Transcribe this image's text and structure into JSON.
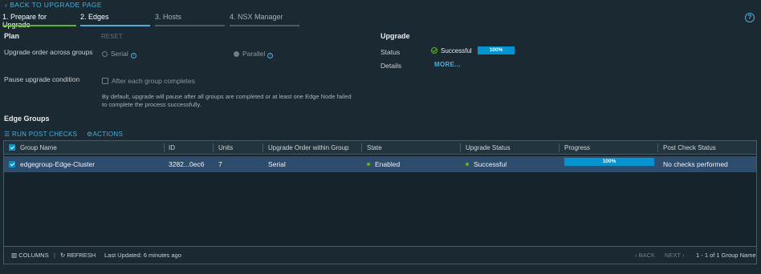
{
  "header": {
    "back_link": "BACK TO UPGRADE PAGE",
    "steps": [
      {
        "label": "1. Prepare for Upgrade",
        "state": "done"
      },
      {
        "label": "2. Edges",
        "state": "active"
      },
      {
        "label": "3. Hosts",
        "state": "future"
      },
      {
        "label": "4. NSX Manager",
        "state": "future"
      }
    ]
  },
  "plan": {
    "title": "Plan",
    "reset_label": "RESET",
    "upgrade_order_label": "Upgrade order across groups",
    "serial_label": "Serial",
    "parallel_label": "Parallel",
    "pause_label": "Pause upgrade condition",
    "pause_checkbox_label": "After each group completes",
    "pause_note_line1": "By default, upgrade will pause after all groups are completed or at least one Edge Node failed",
    "pause_note_line2": "to complete the process successfully."
  },
  "upgrade": {
    "title": "Upgrade",
    "status_label": "Status",
    "status_value": "Successful",
    "progress_text": "100%",
    "progress_value": 100,
    "details_label": "Details",
    "more_link": "MORE..."
  },
  "edge_groups": {
    "title": "Edge Groups",
    "run_post_checks": "RUN POST CHECKS",
    "actions": "ACTIONS",
    "columns": [
      "Group Name",
      "ID",
      "Units",
      "Upgrade Order within Group",
      "State",
      "Upgrade Status",
      "Progress",
      "Post Check Status"
    ],
    "rows": [
      {
        "group_name": "edgegroup-Edge-Cluster",
        "id": "3282...0ec6",
        "units": "7",
        "order": "Serial",
        "state": "Enabled",
        "upgrade_status": "Successful",
        "progress_text": "100%",
        "progress_value": 100,
        "post_check": "No checks performed"
      }
    ],
    "footer": {
      "columns": "COLUMNS",
      "refresh": "REFRESH",
      "last_updated": "Last Updated: 6 minutes ago",
      "back": "BACK",
      "next": "NEXT",
      "range": "1 - 1 of 1 Group Name"
    }
  },
  "colors": {
    "background": "#1b2a32",
    "accent": "#49afd9",
    "progress": "#0095d3",
    "success": "#5eb715",
    "row_selected": "#2e4c6b"
  },
  "icons": [
    "chevron-left-icon",
    "help-icon",
    "info-icon",
    "success-check-icon",
    "list-icon",
    "gear-icon",
    "columns-icon",
    "refresh-icon"
  ]
}
